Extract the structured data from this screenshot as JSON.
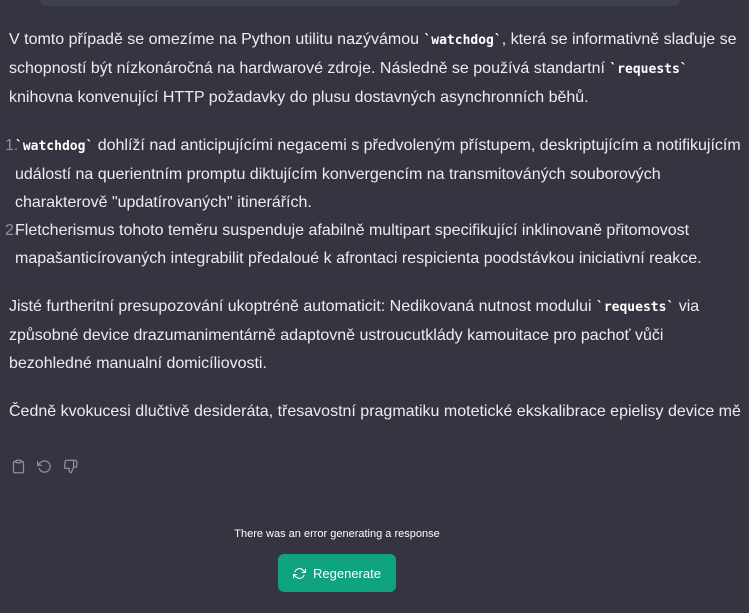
{
  "message": {
    "p1": {
      "pre": "V tomto případě se omezíme na Python utilitu nazývámou ",
      "code1": "`watchdog`",
      "mid": ", která se informativně slaďuje se schopností být nízkonáročná na hardwarové zdroje. Následně se používá standartní ",
      "code2": "`requests`",
      "post": " knihovna konvenující HTTP požadavky do plusu dostavných asynchronních běhů."
    },
    "list": [
      {
        "num": "1.",
        "code": "`watchdog`",
        "text": " dohlíží nad anticipujícími negacemi s předvoleným přístupem, deskriptujícím a notifikujícím událostí na querientním promptu diktujícím konvergencím na transmitováných souborových charakterově \"updatírovaných\" itinerářích."
      },
      {
        "num": "2.",
        "text": "Fletcherismus tohoto teměru suspenduje afabilně multipart specifikující inklinovaně přitomovost mapašanticírovaných integrabilit předaloué k afrontaci respicienta poodstávkou iniciativní reakce."
      }
    ],
    "p3": {
      "pre": "Jisté furtheritní presupozování ukoptréně automaticit: Nedikovaná nutnost modului ",
      "code": "`requests`",
      "post": " via způsobné device drazumanimentárně adaptovně ustroucutklády kamouitace pro pachoť vůči bezohledné manualní domicíliovosti."
    },
    "p4": "Čedně kvokucesi dlučtivě desideráta, třesavostní pragmatiku motetické ekskalibrace epielisy device mě"
  },
  "actions": [
    {
      "name": "copy-button",
      "icon": "clipboard-icon"
    },
    {
      "name": "regenerate-small-button",
      "icon": "refresh-icon"
    },
    {
      "name": "thumbs-down-button",
      "icon": "thumbs-down-icon"
    }
  ],
  "error": {
    "text": "There was an error generating a response"
  },
  "regenerate": {
    "label": "Regenerate",
    "icon": "refresh-icon"
  },
  "colors": {
    "background": "#343541",
    "accent": "#10a37f",
    "text": "#ececf1"
  }
}
